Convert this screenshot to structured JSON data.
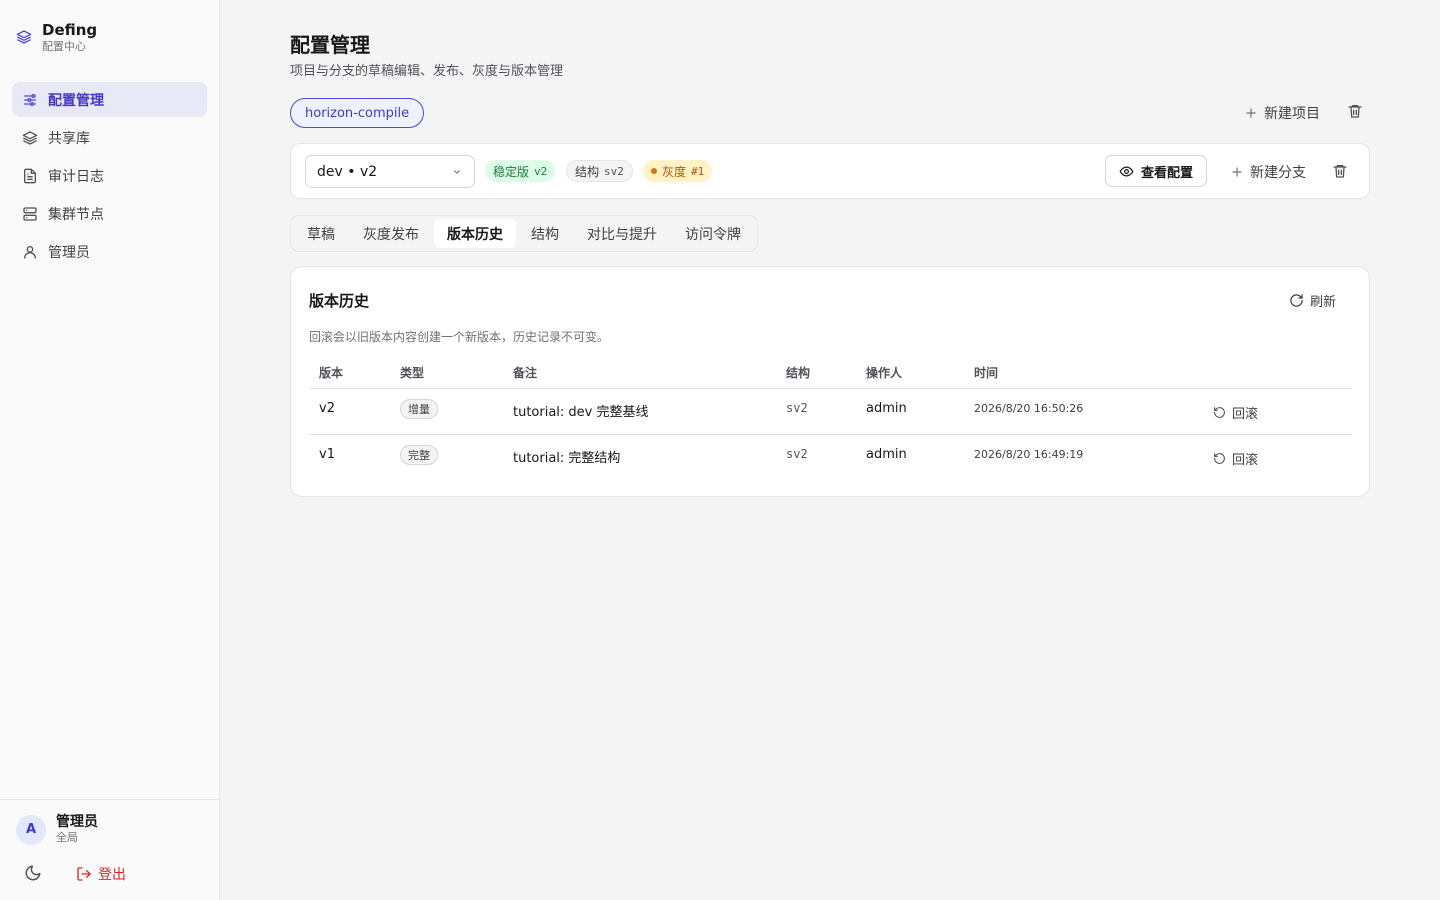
{
  "brand": {
    "name": "Defing",
    "subtitle": "配置中心"
  },
  "nav": [
    {
      "label": "配置管理",
      "icon": "sliders-icon",
      "active": true
    },
    {
      "label": "共享库",
      "icon": "layers-icon"
    },
    {
      "label": "审计日志",
      "icon": "file-text-icon"
    },
    {
      "label": "集群节点",
      "icon": "server-icon"
    },
    {
      "label": "管理员",
      "icon": "user-icon"
    }
  ],
  "user": {
    "avatar": "A",
    "name": "管理员",
    "scope": "全局",
    "logout": "登出"
  },
  "page": {
    "title": "配置管理",
    "subtitle": "项目与分支的草稿编辑、发布、灰度与版本管理"
  },
  "project": {
    "name": "horizon-compile",
    "new_label": "新建项目"
  },
  "branch": {
    "selected": "dev • v2",
    "stable_label": "稳定版",
    "stable_version": "v2",
    "schema_label": "结构",
    "schema_version": "sv2",
    "gray_label": "灰度",
    "gray_count": "#1",
    "view_config": "查看配置",
    "new_branch": "新建分支"
  },
  "tabs": [
    "草稿",
    "灰度发布",
    "版本历史",
    "结构",
    "对比与提升",
    "访问令牌"
  ],
  "active_tab": "版本历史",
  "history": {
    "title": "版本历史",
    "refresh": "刷新",
    "description": "回滚会以旧版本内容创建一个新版本，历史记录不可变。",
    "columns": [
      "版本",
      "类型",
      "备注",
      "结构",
      "操作人",
      "时间"
    ],
    "rows": [
      {
        "version": "v2",
        "type": "增量",
        "note": "tutorial: dev 完整基线",
        "schema": "sv2",
        "operator": "admin",
        "time": "2026/8/20 16:50:26",
        "action": "回滚"
      },
      {
        "version": "v1",
        "type": "完整",
        "note": "tutorial: 完整结构",
        "schema": "sv2",
        "operator": "admin",
        "time": "2026/8/20 16:49:19",
        "action": "回滚"
      }
    ]
  },
  "colors": {
    "accent": "#4f46e5",
    "stable": "#15803d",
    "gray": "#b45309",
    "danger": "#dc2626"
  }
}
